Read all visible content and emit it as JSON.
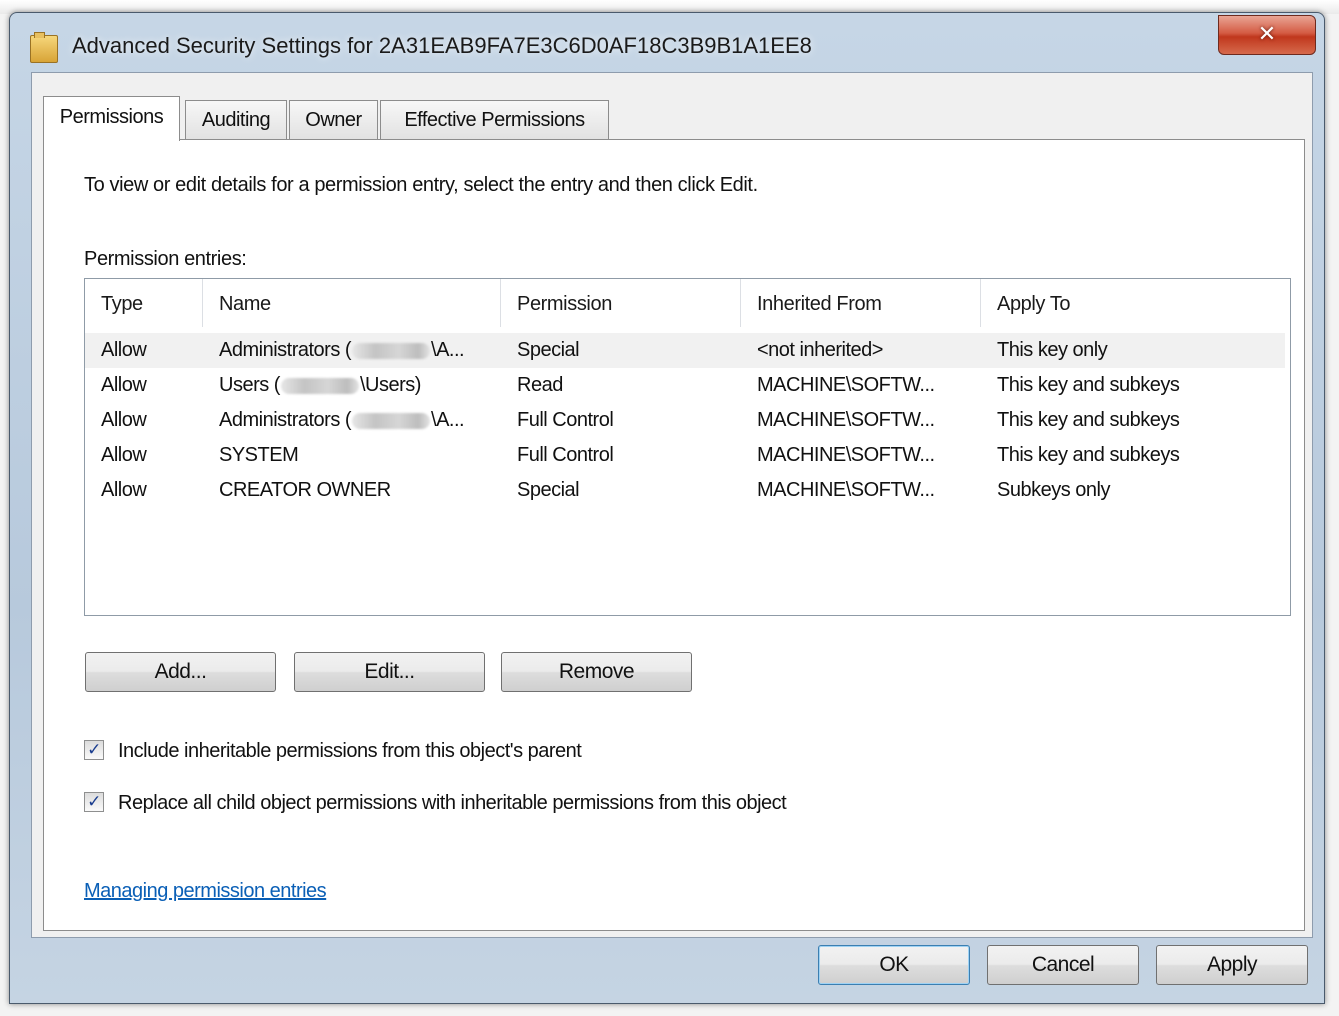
{
  "window": {
    "title": "Advanced Security Settings for 2A31EAB9FA7E3C6D0AF18C3B9B1A1EE8",
    "close_glyph": "✕"
  },
  "tabs": [
    {
      "label": "Permissions",
      "active": true
    },
    {
      "label": "Auditing",
      "active": false
    },
    {
      "label": "Owner",
      "active": false
    },
    {
      "label": "Effective Permissions",
      "active": false
    }
  ],
  "permissions": {
    "instructions": "To view or edit details for a permission entry, select the entry and then click Edit.",
    "entries_label": "Permission entries:",
    "columns": [
      "Type",
      "Name",
      "Permission",
      "Inherited From",
      "Apply To"
    ],
    "rows": [
      {
        "type": "Allow",
        "name_pre": "Administrators (",
        "name_post": "\\A...",
        "permission": "Special",
        "inherited_from": "<not inherited>",
        "apply_to": "This key only"
      },
      {
        "type": "Allow",
        "name_pre": "Users (",
        "name_post": "\\Users)",
        "permission": "Read",
        "inherited_from": "MACHINE\\SOFTW...",
        "apply_to": "This key and subkeys"
      },
      {
        "type": "Allow",
        "name_pre": "Administrators (",
        "name_post": "\\A...",
        "permission": "Full Control",
        "inherited_from": "MACHINE\\SOFTW...",
        "apply_to": "This key and subkeys"
      },
      {
        "type": "Allow",
        "name_pre": "SYSTEM",
        "name_post": "",
        "permission": "Full Control",
        "inherited_from": "MACHINE\\SOFTW...",
        "apply_to": "This key and subkeys"
      },
      {
        "type": "Allow",
        "name_pre": "CREATOR OWNER",
        "name_post": "",
        "permission": "Special",
        "inherited_from": "MACHINE\\SOFTW...",
        "apply_to": "Subkeys only"
      }
    ],
    "buttons": {
      "add": "Add...",
      "edit": "Edit...",
      "remove": "Remove"
    },
    "include_inheritable": {
      "label": "Include inheritable permissions from this object's parent",
      "checked": true
    },
    "replace_child": {
      "label": "Replace all child object permissions with inheritable permissions from this object",
      "checked": true
    },
    "help_link": "Managing permission entries"
  },
  "footer": {
    "ok": "OK",
    "cancel": "Cancel",
    "apply": "Apply"
  },
  "check_glyph": "✓"
}
